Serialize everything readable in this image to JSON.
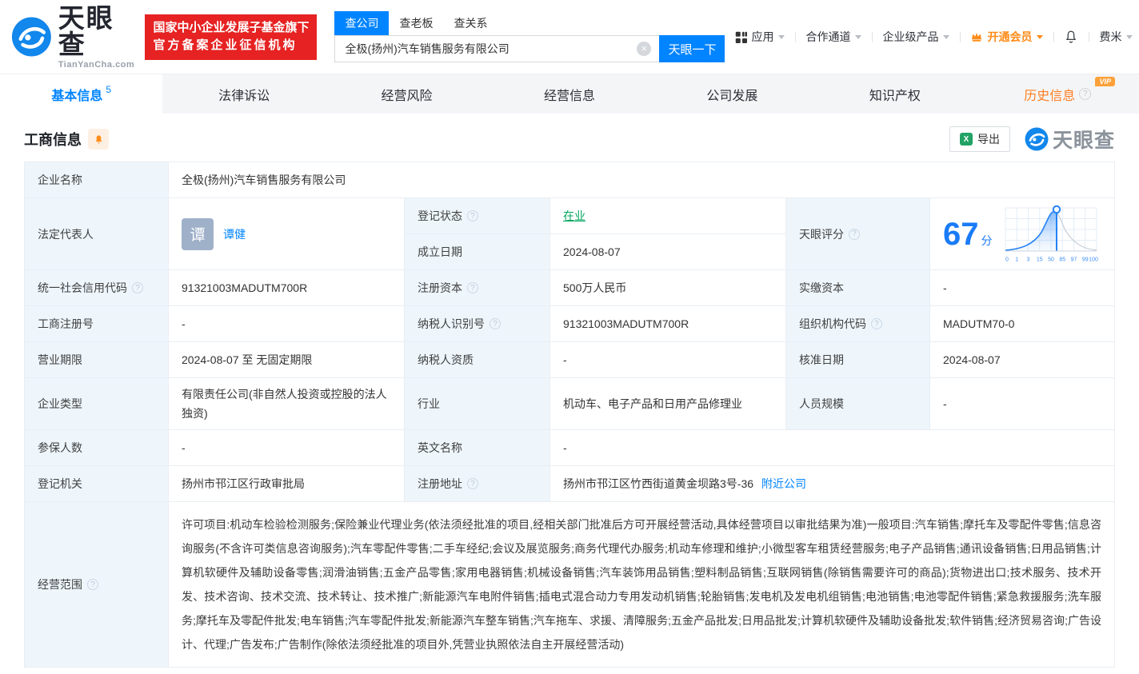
{
  "icons": {
    "help": "?",
    "clear": "×",
    "excel": "X"
  },
  "header": {
    "logo_title": "天眼查",
    "logo_subtitle": "TianYanCha.com",
    "badge_line1": "国家中小企业发展子基金旗下",
    "badge_line2": "官方备案企业征信机构",
    "search_tabs": [
      {
        "label": "查公司"
      },
      {
        "label": "查老板"
      },
      {
        "label": "查关系"
      }
    ],
    "search_value": "全极(扬州)汽车销售服务有限公司",
    "search_button": "天眼一下",
    "nav": {
      "apps": "应用",
      "coop": "合作通道",
      "enterprise": "企业级产品",
      "vip": "开通会员",
      "user": "费米"
    }
  },
  "tabs": [
    {
      "label": "基本信息",
      "count": "5"
    },
    {
      "label": "法律诉讼"
    },
    {
      "label": "经营风险"
    },
    {
      "label": "经营信息"
    },
    {
      "label": "公司发展"
    },
    {
      "label": "知识产权"
    },
    {
      "label": "历史信息",
      "vip_badge": "VIP"
    }
  ],
  "section": {
    "title": "工商信息",
    "export_label": "导出",
    "watermark": "天眼查"
  },
  "score": {
    "label": "天眼评分",
    "value": "67",
    "unit": "分",
    "axis": [
      "0",
      "1",
      "3",
      "15",
      "50",
      "85",
      "97",
      "99",
      "100"
    ]
  },
  "table": {
    "company_name": {
      "label": "企业名称",
      "value": "全极(扬州)汽车销售服务有限公司"
    },
    "legal_rep": {
      "label": "法定代表人",
      "avatar": "谭",
      "name": "谭健"
    },
    "reg_status": {
      "label": "登记状态",
      "value": "在业"
    },
    "est_date": {
      "label": "成立日期",
      "value": "2024-08-07"
    },
    "credit_code": {
      "label": "统一社会信用代码",
      "value": "91321003MADUTM700R"
    },
    "reg_capital": {
      "label": "注册资本",
      "value": "500万人民币"
    },
    "paid_capital": {
      "label": "实缴资本",
      "value": "-"
    },
    "reg_number": {
      "label": "工商注册号",
      "value": "-"
    },
    "taxpayer_id": {
      "label": "纳税人识别号",
      "value": "91321003MADUTM700R"
    },
    "org_code": {
      "label": "组织机构代码",
      "value": "MADUTM70-0"
    },
    "business_term": {
      "label": "营业期限",
      "value": "2024-08-07 至 无固定期限"
    },
    "taxpayer_quali": {
      "label": "纳税人资质",
      "value": "-"
    },
    "approval_date": {
      "label": "核准日期",
      "value": "2024-08-07"
    },
    "company_type": {
      "label": "企业类型",
      "value": "有限责任公司(非自然人投资或控股的法人独资)"
    },
    "industry": {
      "label": "行业",
      "value": "机动车、电子产品和日用产品修理业"
    },
    "staff_size": {
      "label": "人员规模",
      "value": "-"
    },
    "insured_count": {
      "label": "参保人数",
      "value": "-"
    },
    "english_name": {
      "label": "英文名称",
      "value": "-"
    },
    "reg_authority": {
      "label": "登记机关",
      "value": "扬州市邗江区行政审批局"
    },
    "reg_address": {
      "label": "注册地址",
      "value": "扬州市邗江区竹西街道黄金坝路3号-36",
      "link": "附近公司"
    },
    "business_scope": {
      "label": "经营范围",
      "value": "许可项目:机动车检验检测服务;保险兼业代理业务(依法须经批准的项目,经相关部门批准后方可开展经营活动,具体经营项目以审批结果为准)一般项目:汽车销售;摩托车及零配件零售;信息咨询服务(不含许可类信息咨询服务);汽车零配件零售;二手车经纪;会议及展览服务;商务代理代办服务;机动车修理和维护;小微型客车租赁经营服务;电子产品销售;通讯设备销售;日用品销售;计算机软硬件及辅助设备零售;润滑油销售;五金产品零售;家用电器销售;机械设备销售;汽车装饰用品销售;塑料制品销售;互联网销售(除销售需要许可的商品);货物进出口;技术服务、技术开发、技术咨询、技术交流、技术转让、技术推广;新能源汽车电附件销售;插电式混合动力专用发动机销售;轮胎销售;发电机及发电机组销售;电池销售;电池零配件销售;紧急救援服务;洗车服务;摩托车及零配件批发;电车销售;汽车零配件批发;新能源汽车整车销售;汽车拖车、求援、清障服务;五金产品批发;日用品批发;计算机软硬件及辅助设备批发;软件销售;经济贸易咨询;广告设计、代理;广告发布;广告制作(除依法须经批准的项目外,凭营业执照依法自主开展经营活动)"
    }
  }
}
